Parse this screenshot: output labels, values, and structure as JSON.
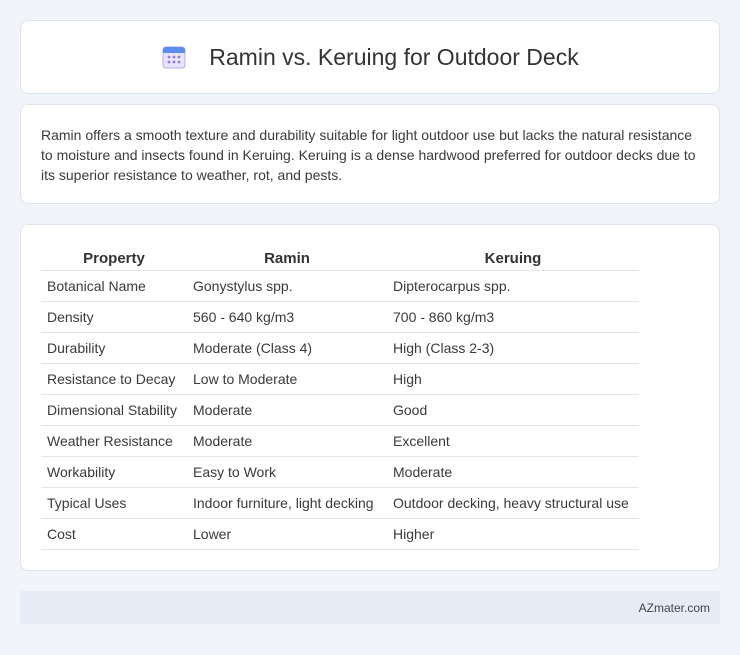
{
  "header": {
    "title": "Ramin vs. Keruing for Outdoor Deck",
    "icon": "calendar-icon"
  },
  "description": "Ramin offers a smooth texture and durability suitable for light outdoor use but lacks the natural resistance to moisture and insects found in Keruing. Keruing is a dense hardwood preferred for outdoor decks due to its superior resistance to weather, rot, and pests.",
  "table": {
    "headers": [
      "Property",
      "Ramin",
      "Keruing"
    ],
    "rows": [
      [
        "Botanical Name",
        "Gonystylus spp.",
        "Dipterocarpus spp."
      ],
      [
        "Density",
        "560 - 640 kg/m3",
        "700 - 860 kg/m3"
      ],
      [
        "Durability",
        "Moderate (Class 4)",
        "High (Class 2-3)"
      ],
      [
        "Resistance to Decay",
        "Low to Moderate",
        "High"
      ],
      [
        "Dimensional Stability",
        "Moderate",
        "Good"
      ],
      [
        "Weather Resistance",
        "Moderate",
        "Excellent"
      ],
      [
        "Workability",
        "Easy to Work",
        "Moderate"
      ],
      [
        "Typical Uses",
        "Indoor furniture, light decking",
        "Outdoor decking, heavy structural use"
      ],
      [
        "Cost",
        "Lower",
        "Higher"
      ]
    ]
  },
  "footer": {
    "brand": "AZmater.com"
  }
}
